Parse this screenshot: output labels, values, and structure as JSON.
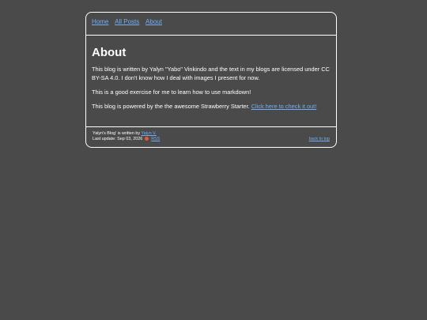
{
  "nav": {
    "items": [
      "Home",
      "All Posts",
      "About"
    ]
  },
  "main": {
    "title": "About",
    "paragraph1": "This blog is written by Yalyn \"Yabo\" Vinkindo and the text in my blogs are licensed under CC BY-SA 4.0. I don't know how I deal with images I present for now.",
    "paragraph2": "This is a good exercise for me to learn how to use markdown!",
    "paragraph3_text": "This blog is powered by the the awesome Strawberry Starter.",
    "paragraph3_link": "Click here to check it out!"
  },
  "footer": {
    "written_by_prefix": "Yalyn's Blog' is written by",
    "author_link": "Yalyn V.",
    "last_update": "Last update: Sep 03, 2026",
    "rss_link": "RSS",
    "back_to_top": "back to top",
    "rss_icon": "strawberry-icon"
  },
  "colors": {
    "background": "#4a4a4a",
    "text": "#ffffff",
    "link": "#72aef5",
    "accent": "#e8593a"
  }
}
